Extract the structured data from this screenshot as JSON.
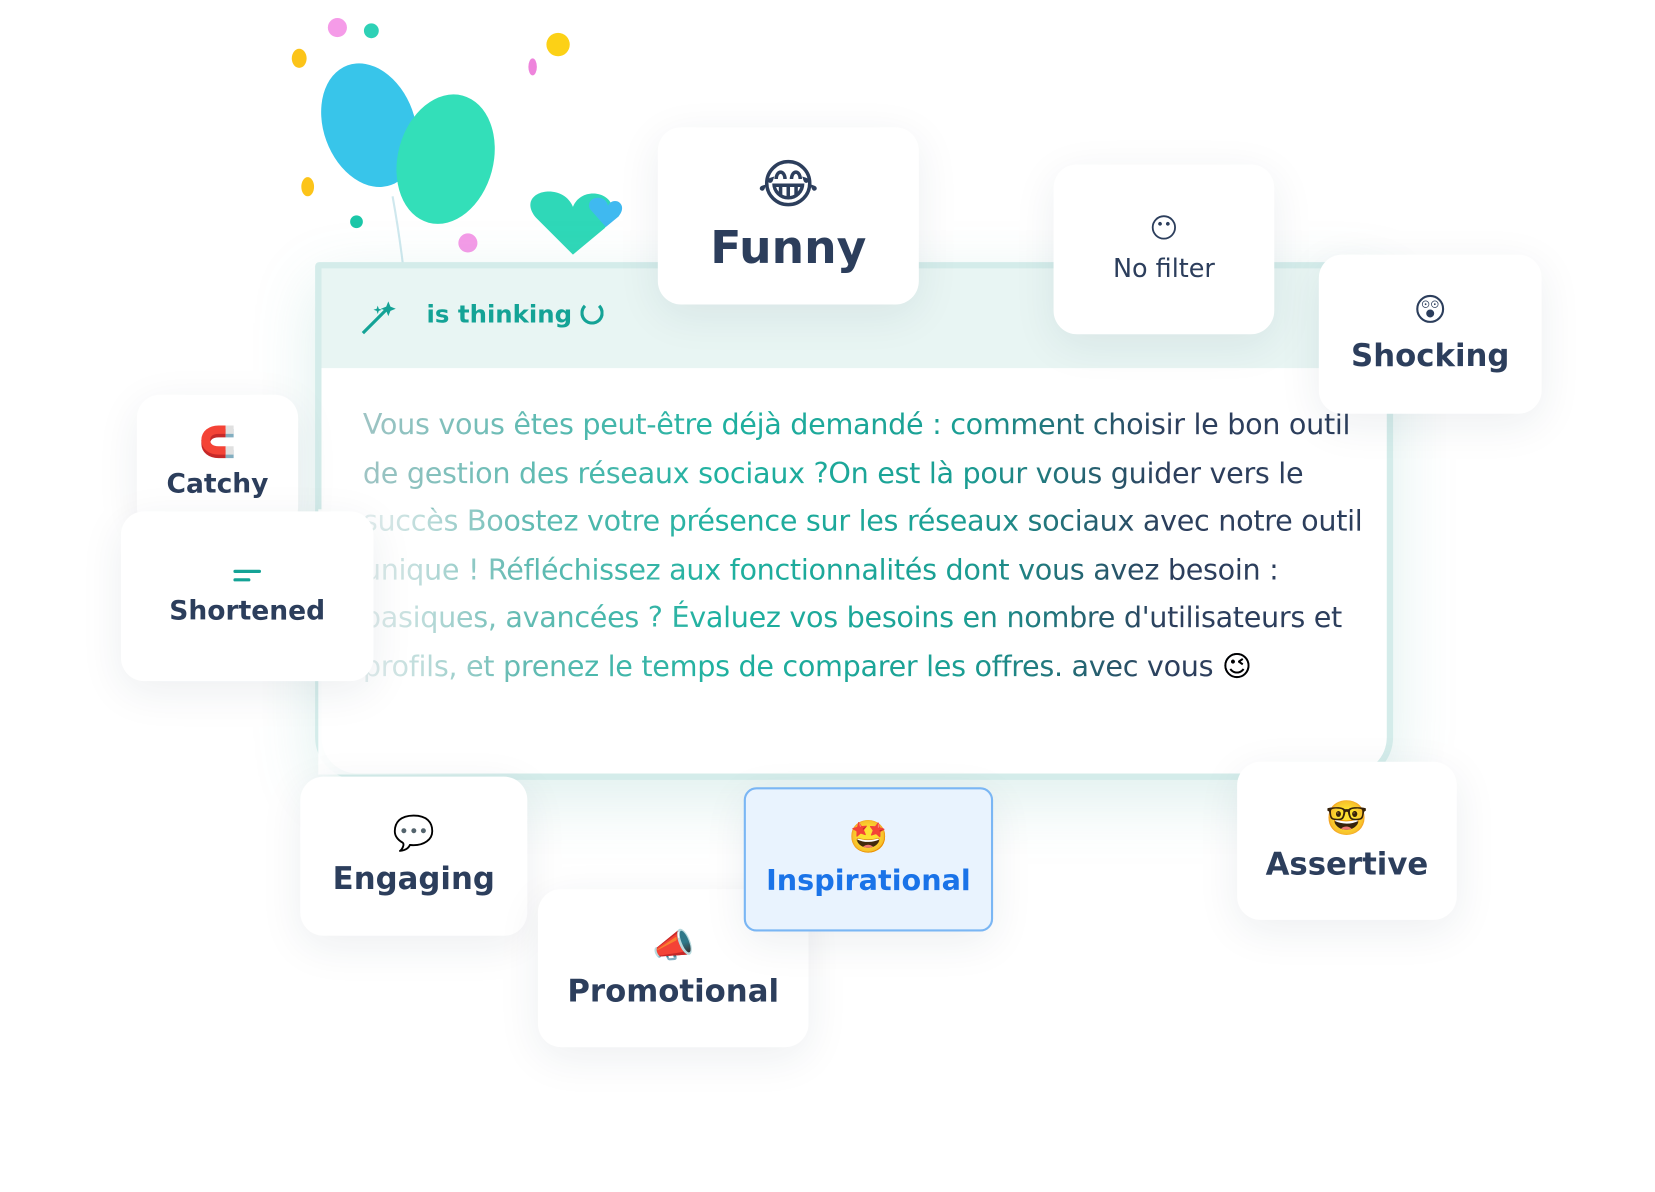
{
  "status": {
    "agent_label": "is thinking"
  },
  "generated_text": "Vous vous êtes peut-être déjà demandé : comment choisir le bon outil de gestion des réseaux sociaux ?On est là pour vous guider vers le succès Boostez votre présence sur les réseaux sociaux avec notre outil unique ! Réfléchissez aux fonctionnalités dont vous avez besoin : basiques, avancées ? Évaluez vos besoins en nombre d'utilisateurs et profils, et prenez le temps de comparer les offres. avec vous",
  "trailing_emoji": "😉",
  "tones": {
    "funny": {
      "label": "Funny",
      "emoji": "😂"
    },
    "no_filter": {
      "label": "No filter",
      "emoji": "😶"
    },
    "shocking": {
      "label": "Shocking",
      "emoji": "😲"
    },
    "catchy": {
      "label": "Catchy",
      "emoji": "🧲"
    },
    "shortened": {
      "label": "Shortened",
      "icon": "short-text-icon"
    },
    "engaging": {
      "label": "Engaging",
      "emoji": "💬"
    },
    "inspirational": {
      "label": "Inspirational",
      "emoji": "🤩",
      "selected": true
    },
    "promotional": {
      "label": "Promotional",
      "emoji": "📣"
    },
    "assertive": {
      "label": "Assertive",
      "emoji": "🤓"
    }
  },
  "colors": {
    "accent": "#14a396",
    "text": "#2c3e5c",
    "selected": "#1a73e8"
  }
}
